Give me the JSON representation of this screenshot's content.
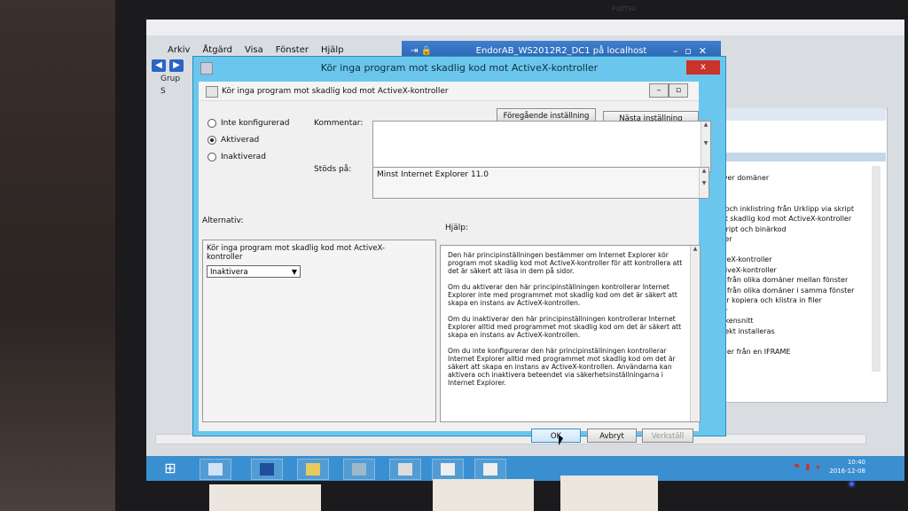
{
  "monitor": {
    "brand_label": "FUJITSU"
  },
  "remote_bar": {
    "title": "EndorAB_WS2012R2_DC1 på localhost"
  },
  "mmc": {
    "menu": [
      "Arkiv",
      "Åtgärd",
      "Visa",
      "Fönster",
      "Hjälp"
    ],
    "tree_items": [
      "Grup",
      "S"
    ],
    "right_pane_items": [
      "r över domäner",
      "ng",
      "SH",
      "ng och inklistring från Urklipp via skript",
      "mot skadlig kod mot ActiveX-kontroller",
      "i skript och binärkod",
      "nster",
      "til",
      "ctiveX-kontroller",
      "ActiveX-kontroller",
      "ras från olika domäner mellan fönster",
      "ras från olika domäner i samma fönster",
      "eller kopiera och klistra in filer",
      "filer",
      "teckensnitt",
      "objekt installeras",
      "",
      "h filer från en IFRAME",
      "tiv",
      "trol"
    ]
  },
  "dialog": {
    "title": "Kör inga program mot skadlig kod mot ActiveX-kontroller",
    "close_label": "x",
    "inner_title": "Kör inga program mot skadlig kod mot ActiveX-kontroller",
    "prev_setting_label": "Föregående inställning",
    "next_setting_label": "Nästa inställning",
    "radio_options": [
      {
        "label": "Inte konfigurerad",
        "checked": false
      },
      {
        "label": "Aktiverad",
        "checked": true
      },
      {
        "label": "Inaktiverad",
        "checked": false
      }
    ],
    "comment_label": "Kommentar:",
    "supported_label": "Stöds på:",
    "supported_value": "Minst Internet Explorer 11.0",
    "options_label": "Alternativ:",
    "help_label": "Hjälp:",
    "option_text": "Kör inga program mot skadlig kod mot ActiveX-kontroller",
    "option_select_value": "Inaktivera",
    "help_paragraphs": [
      "Den här principinställningen bestämmer om Internet Explorer kör program mot skadlig kod mot ActiveX-kontroller för att kontrollera att det är säkert att läsa in dem på sidor.",
      "Om du aktiverar den här principinställningen kontrollerar Internet Explorer inte med programmet mot skadlig kod om det är säkert att skapa en instans av ActiveX-kontrollen.",
      "Om du inaktiverar den här principinställningen kontrollerar Internet Explorer alltid med programmet mot skadlig kod om det är säkert att skapa en instans av ActiveX-kontrollen.",
      "Om du inte konfigurerar den här principinställningen kontrollerar Internet Explorer alltid med programmet mot skadlig kod om det är säkert att skapa en instans av ActiveX-kontrollen. Användarna kan aktivera och inaktivera beteendet via säkerhetsinställningarna i Internet Explorer."
    ],
    "ok_label": "OK",
    "cancel_label": "Avbryt",
    "apply_label": "Verkställ"
  },
  "taskbar": {
    "time": "10:40",
    "date": "2016-12-08"
  },
  "colors": {
    "dialog_frame": "#6ac6ec",
    "taskbar": "#3a8fd0",
    "close_button": "#c9342a"
  }
}
